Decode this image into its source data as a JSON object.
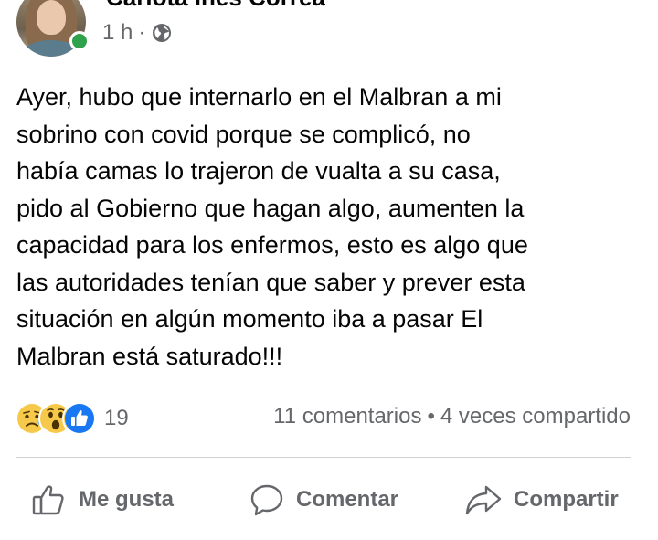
{
  "post": {
    "author": "Carlota Inés Correa",
    "time": "1 h",
    "time_separator": "·",
    "privacy_icon": "globe-icon",
    "text": "Ayer, hubo que internarlo en el Malbran a mi\nsobrino con covid porque se complicó, no\nhabía camas lo trajeron de vualta a su casa,\npido al Gobierno que hagan algo, aumenten la\ncapacidad para los enfermos, esto es algo que\nlas autoridades tenían que saber y prever esta\nsituación en algún momento iba a pasar El\nMalbran está saturado!!!"
  },
  "reactions": {
    "types": [
      "sad",
      "wow",
      "like"
    ],
    "count": "19"
  },
  "stats": {
    "comments": "11 comentarios",
    "separator": "•",
    "shares": "4 veces compartido"
  },
  "actions": {
    "like": "Me gusta",
    "comment": "Comentar",
    "share": "Compartir"
  },
  "colors": {
    "secondary_text": "#65676b",
    "online": "#31a24c",
    "like_blue": "#1877f2",
    "emoji_yellow": "#f7c94b"
  }
}
